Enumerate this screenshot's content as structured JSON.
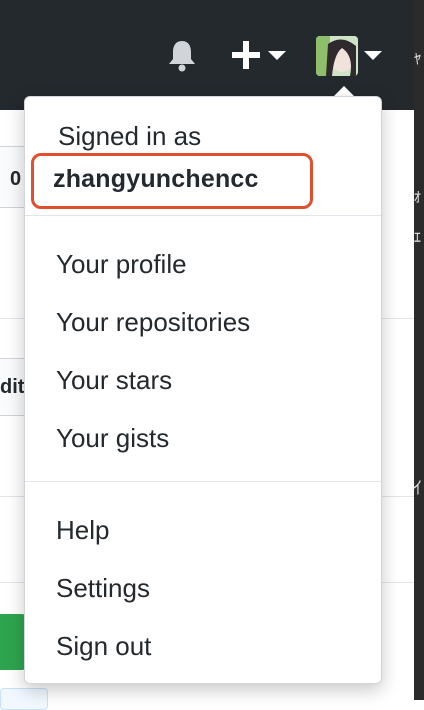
{
  "header": {
    "icons": [
      "bell-icon",
      "plus-icon",
      "chevron-down-icon",
      "avatar"
    ],
    "background_color": "#24292e"
  },
  "dropdown": {
    "signed_in_label": "Signed in as",
    "username": "zhangyunchencc",
    "highlight_color": "#e0502e",
    "section1": [
      "Your profile",
      "Your repositories",
      "Your stars",
      "Your gists"
    ],
    "section2": [
      "Help",
      "Settings",
      "Sign out"
    ]
  },
  "background_fragments": {
    "number_fragment": "0",
    "edit_fragment": "dit"
  }
}
